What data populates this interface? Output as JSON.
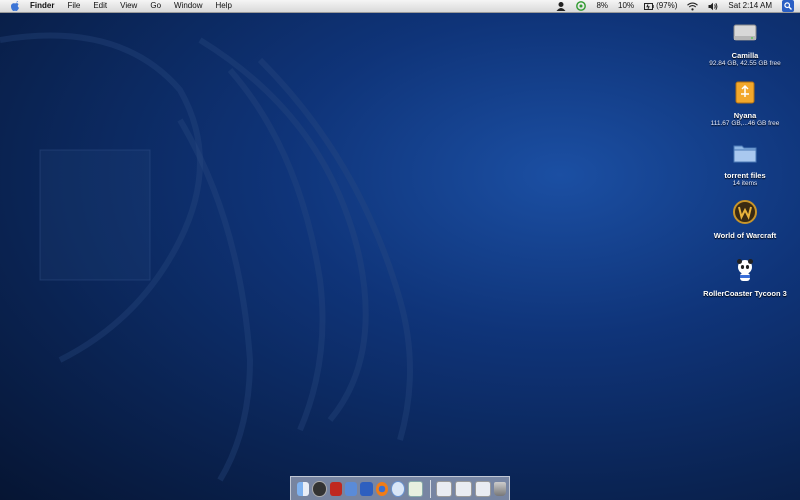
{
  "menubar": {
    "apple_icon": "apple-icon",
    "items": [
      "Finder",
      "File",
      "Edit",
      "View",
      "Go",
      "Window",
      "Help"
    ],
    "tray": {
      "cpu_percent": "8%",
      "volume_percent": "10%",
      "battery": "(97%)",
      "clock": "Sat 2:14 AM"
    }
  },
  "desktop_icons": [
    {
      "name": "Camilla",
      "detail": "92.84 GB, 42.55 GB free",
      "icon": "hard-drive-icon"
    },
    {
      "name": "Nyana",
      "detail": "111.67 GB,...46 GB free",
      "icon": "external-drive-icon"
    },
    {
      "name": "torrent files",
      "detail": "14 items",
      "icon": "folder-icon"
    },
    {
      "name": "World of Warcraft",
      "detail": "",
      "icon": "warcraft-icon"
    },
    {
      "name": "RollerCoaster Tycoon 3",
      "detail": "",
      "icon": "panda-icon"
    }
  ],
  "dock": {
    "apps": [
      "finder-icon",
      "dashboard-icon",
      "red-app-icon",
      "stamp-app-icon",
      "mail-app-icon",
      "firefox-icon",
      "itunes-icon",
      "preview-icon"
    ],
    "docs": [
      "window-minimized-icon",
      "window-minimized-icon",
      "window-minimized-icon",
      "trash-icon"
    ]
  },
  "colors": {
    "desktop_blue": "#0f3479",
    "menubar_bg": "#e8e8e8",
    "spotlight_blue": "#2a5fc4"
  }
}
